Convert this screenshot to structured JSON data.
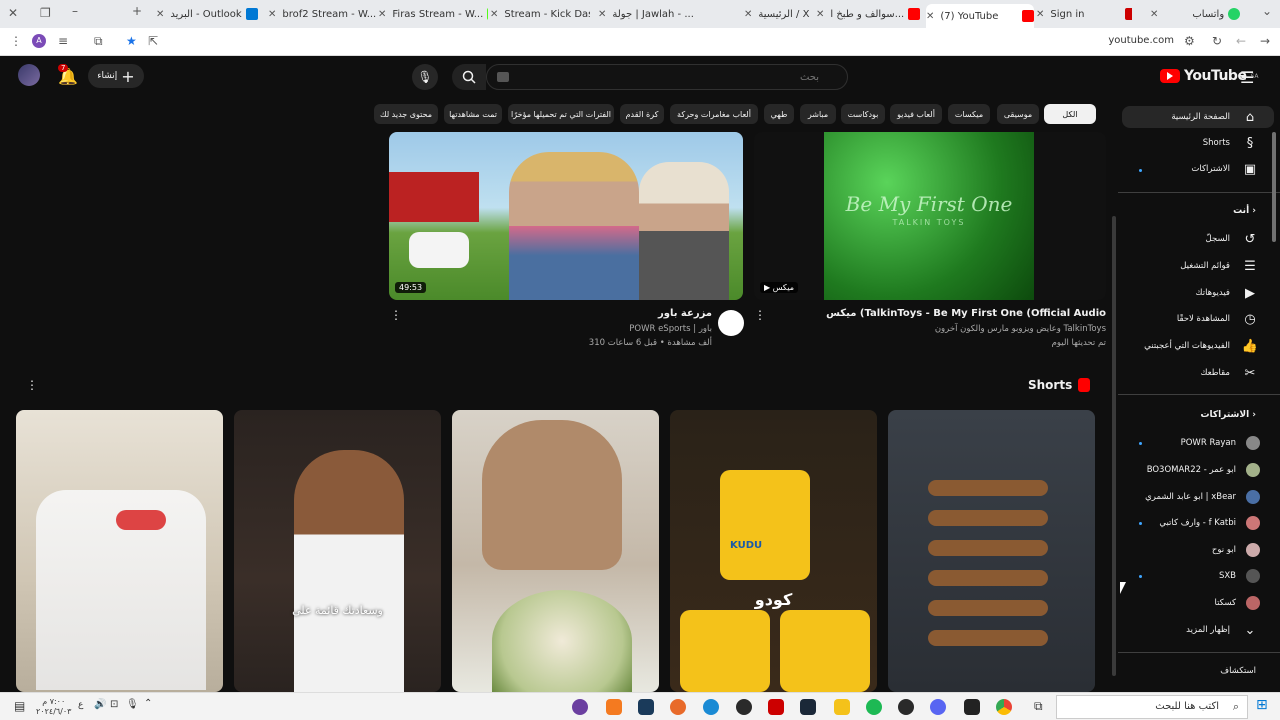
{
  "browser": {
    "tabs": [
      {
        "title": "واتساب",
        "color": "#25d366"
      },
      {
        "title": "",
        "color": "#c00"
      },
      {
        "title": "Sign in",
        "color": "#c00"
      },
      {
        "title": "(7) YouTube",
        "color": "#ff0000"
      },
      {
        "title": "سوالف و طبخ ا...",
        "color": "#ff0000"
      },
      {
        "title": "الرئيسية / X",
        "color": "#000"
      },
      {
        "title": "جولة | Jawlah - ...",
        "color": "#ddd"
      },
      {
        "title": "Stream - Kick Das...",
        "color": "#53fc18"
      },
      {
        "title": "Firas Stream - W...",
        "color": "#53fc18"
      },
      {
        "title": "brof2 Stream - W...",
        "color": "#53fc18"
      },
      {
        "title": "البريد - Outlook",
        "color": "#0078d4"
      }
    ],
    "url": "youtube.com"
  },
  "youtube": {
    "logo_text": "YouTube",
    "logo_region": "SA",
    "search_placeholder": "بحث",
    "create_label": "إنشاء",
    "notification_count": "7",
    "chips": [
      "الكل",
      "موسيقى",
      "ميكسات",
      "ألعاب فيديو",
      "بودكاست",
      "مباشر",
      "طهي",
      "ألعاب مغامرات وحركة",
      "كرة القدم",
      "الفترات التي تم تحميلها مؤخرًا",
      "تمت مشاهدتها",
      "محتوى جديد لك"
    ],
    "sidebar": {
      "main": [
        {
          "label": "الصفحة الرئيسية",
          "icon": "home-icon"
        },
        {
          "label": "Shorts",
          "icon": "shorts-icon"
        },
        {
          "label": "الاشتراكات",
          "icon": "subscriptions-icon"
        }
      ],
      "you_header": "أنت",
      "you_items": [
        {
          "label": "السجلّ",
          "icon": "history-icon"
        },
        {
          "label": "قوائم التشغيل",
          "icon": "playlists-icon"
        },
        {
          "label": "فيديوهاتك",
          "icon": "your-videos-icon"
        },
        {
          "label": "المشاهدة لاحقًا",
          "icon": "watch-later-icon"
        },
        {
          "label": "الفيديوهات التي أعجبتني",
          "icon": "liked-icon"
        },
        {
          "label": "مقاطعك",
          "icon": "clips-icon"
        }
      ],
      "subs_header": "الاشتراكات",
      "subs": [
        {
          "label": "POWR Rayan",
          "color": "#888"
        },
        {
          "label": "BO3OMAR22 - ابو عمر",
          "color": "#a3b18a"
        },
        {
          "label": "ابو عابد الشمري | xBear",
          "color": "#4a6fa5"
        },
        {
          "label": "وارف كاتبي - f Katbi",
          "color": "#c77"
        },
        {
          "label": "ابو نوح",
          "color": "#caa"
        },
        {
          "label": "SXB",
          "color": "#555"
        },
        {
          "label": "كسكتا",
          "color": "#b66"
        }
      ],
      "show_more": "إظهار المزيد",
      "explore_header": "استكشاف"
    },
    "videos": [
      {
        "title": "ميكس (TalkinToys - Be My First One (Official Audio",
        "channel": "وعايض ويزوبو مارس والكون آخرون TalkinToys",
        "meta": "تم تحديثها اليوم",
        "badge": "ميكس",
        "thumb_text": "Be My First One",
        "thumb_sub": "TALKIN TOYS"
      },
      {
        "title": "مزرعة باور",
        "channel": "POWR eSports | باور",
        "meta": "310 ألف مشاهدة • قبل 6 ساعات",
        "duration": "49:53"
      }
    ],
    "shorts_header": "Shorts",
    "shorts_captions": [
      "",
      "",
      "",
      "وسعادتك قائمة على",
      ""
    ],
    "shorts_texts": [
      "كودو",
      "KUDU"
    ]
  },
  "taskbar": {
    "search_placeholder": "اكتب هنا للبحث",
    "time": "٧:٠٠ م",
    "date": "٢٠٢٤/٦/٠٣",
    "lang": "ع"
  }
}
